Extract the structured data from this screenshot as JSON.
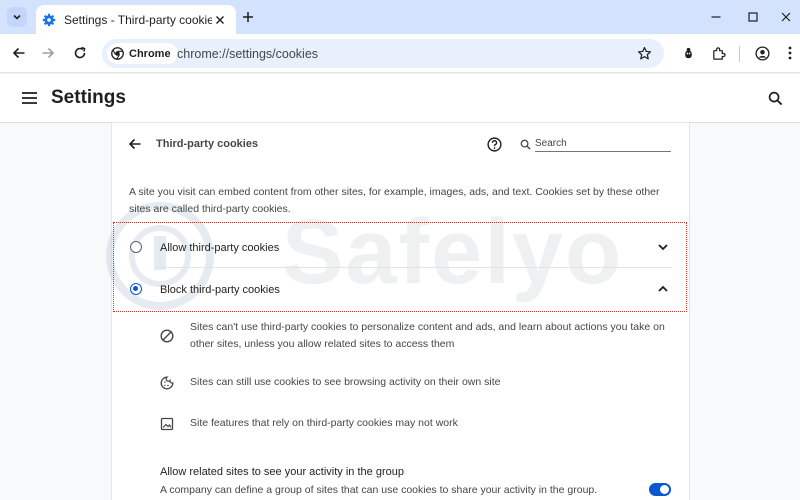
{
  "browser": {
    "tab_title": "Settings - Third-party cookies",
    "omnibox_chip": "Chrome",
    "url": "chrome://settings/cookies"
  },
  "header": {
    "title": "Settings"
  },
  "page": {
    "subtitle": "Third-party cookies",
    "search_placeholder": "Search",
    "description": "A site you visit can embed content from other sites, for example, images, ads, and text. Cookies set by these other sites are called third-party cookies."
  },
  "options": [
    {
      "label": "Allow third-party cookies",
      "selected": false,
      "expanded": false
    },
    {
      "label": "Block third-party cookies",
      "selected": true,
      "expanded": true
    }
  ],
  "details": [
    {
      "icon": "block-icon",
      "text": "Sites can't use third-party cookies to personalize content and ads, and learn about actions you take on other sites, unless you allow related sites to access them"
    },
    {
      "icon": "cookie-icon",
      "text": "Sites can still use cookies to see browsing activity on their own site"
    },
    {
      "icon": "image-icon",
      "text": "Site features that rely on third-party cookies may not work"
    }
  ],
  "related_sites": {
    "title": "Allow related sites to see your activity in the group",
    "description": "A company can define a group of sites that can use cookies to share your activity in the group.",
    "toggle_on": true
  },
  "watermark": "Safelyo",
  "colors": {
    "accent": "#0b57d0",
    "tab_strip": "#d3e3fd",
    "omnibox": "#e8f0fe",
    "highlight_border": "#d93025"
  }
}
